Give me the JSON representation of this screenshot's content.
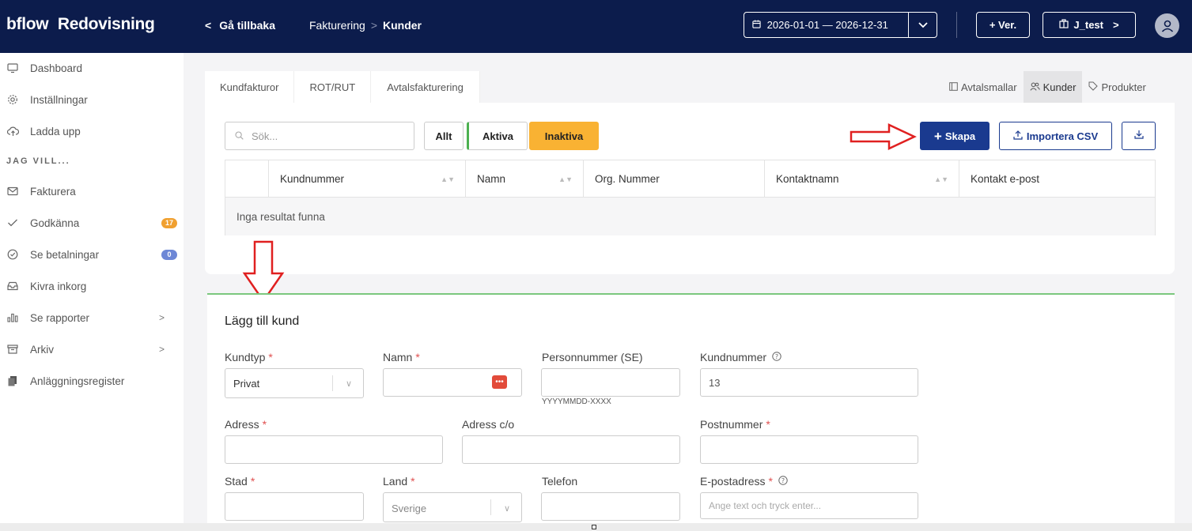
{
  "topbar": {
    "logo_brand": "bflow",
    "logo_product": "Redovisning",
    "back_label": "Gå tillbaka",
    "breadcrumb": [
      "Fakturering",
      "Kunder"
    ],
    "date_range": "2026-01-01 — 2026-12-31",
    "ver_label": "+ Ver.",
    "company_label": "J_test"
  },
  "sidebar": {
    "items": [
      {
        "label": "Dashboard"
      },
      {
        "label": "Inställningar"
      },
      {
        "label": "Ladda upp"
      }
    ],
    "section_header": "JAG VILL...",
    "items2": [
      {
        "label": "Fakturera"
      },
      {
        "label": "Godkänna",
        "badge": "17",
        "badge_color": "#f0a030"
      },
      {
        "label": "Se betalningar",
        "badge": "0",
        "badge_color": "#6d87d6"
      },
      {
        "label": "Kivra inkorg"
      },
      {
        "label": "Se rapporter"
      },
      {
        "label": "Arkiv"
      },
      {
        "label": "Anläggningsregister"
      }
    ]
  },
  "tabs": [
    "Kundfakturor",
    "ROT/RUT",
    "Avtalsfakturering"
  ],
  "right_tabs": [
    "Avtalsmallar",
    "Kunder",
    "Produkter"
  ],
  "toolbar": {
    "search_placeholder": "Sök...",
    "filter_all": "Allt",
    "filter_active": "Aktiva",
    "filter_inactive": "Inaktiva",
    "create_label": "Skapa",
    "import_label": "Importera CSV"
  },
  "table": {
    "columns": [
      "Kundnummer",
      "Namn",
      "Org. Nummer",
      "Kontaktnamn",
      "Kontakt e-post"
    ],
    "empty_text": "Inga resultat funna"
  },
  "form": {
    "title": "Lägg till kund",
    "kundtyp_label": "Kundtyp",
    "kundtyp_value": "Privat",
    "namn_label": "Namn",
    "personnummer_label": "Personnummer (SE)",
    "personnummer_hint": "YYYYMMDD-XXXX",
    "kundnummer_label": "Kundnummer",
    "kundnummer_value": "13",
    "adress_label": "Adress",
    "adress_co_label": "Adress c/o",
    "postnummer_label": "Postnummer",
    "stad_label": "Stad",
    "land_label": "Land",
    "land_value": "Sverige",
    "telefon_label": "Telefon",
    "epost_label": "E-postadress",
    "epost_placeholder": "Ange text och tryck enter..."
  },
  "colors": {
    "topbar": "#0c1c4c",
    "primary": "#1a3a8f",
    "inactive_filter": "#f9b233",
    "active_filter_border": "#4cb050",
    "annotation_arrow": "#e02020",
    "required": "#e05050"
  }
}
